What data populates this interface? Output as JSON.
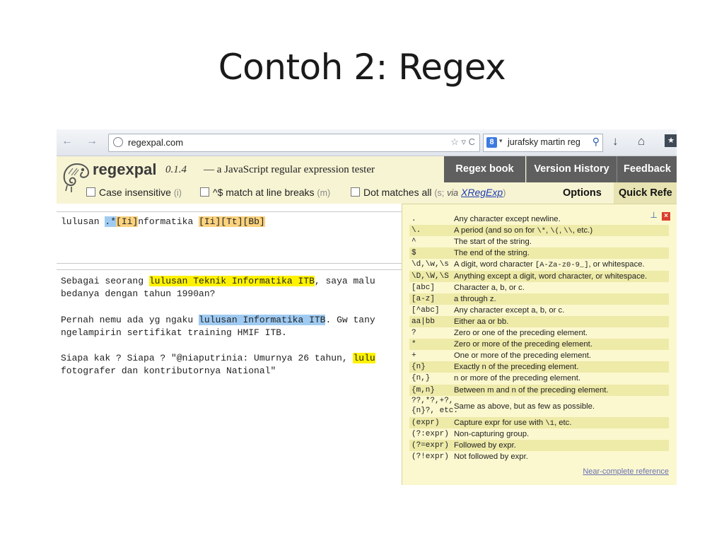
{
  "slide": {
    "title": "Contoh 2: Regex"
  },
  "browser": {
    "back_icon": "arrow-left-icon",
    "forward_icon": "arrow-right-icon",
    "url": "regexpal.com",
    "url_controls": "☆ ▿ C",
    "search_engine_badge": "8",
    "search_text": "jurafsky martin reg",
    "download_icon": "↓",
    "home_icon": "⌂"
  },
  "regexpal": {
    "name": "regexpal",
    "version": "0.1.4",
    "tagline": "— a JavaScript regular expression tester",
    "nav": [
      "Regex book",
      "Version History",
      "Feedback"
    ],
    "options": {
      "case_insensitive": "Case insensitive",
      "case_insensitive_key": "(i)",
      "line_breaks": "^$ match at line breaks",
      "line_breaks_key": "(m)",
      "dot_all": "Dot matches all",
      "dot_all_key": "(s;",
      "via": "via",
      "xregexp": "XRegExp",
      "close_paren": ")"
    },
    "tabs": [
      "Options",
      "Quick Refe"
    ]
  },
  "regex_input": {
    "segments": [
      {
        "text": "lulusan ",
        "hl": ""
      },
      {
        "text": ".*",
        "hl": "blue"
      },
      {
        "text": "[Ii]",
        "hl": "orange"
      },
      {
        "text": "nformatika ",
        "hl": ""
      },
      {
        "text": "[Ii]",
        "hl": "orange"
      },
      {
        "text": "[Tt]",
        "hl": "orange"
      },
      {
        "text": "[Bb]",
        "hl": "orange"
      }
    ]
  },
  "test_text": {
    "lines": [
      [
        {
          "text": "Sebagai seorang ",
          "hl": ""
        },
        {
          "text": "lulusan Teknik Informatika ITB",
          "hl": "yellow"
        },
        {
          "text": ", saya malu",
          "hl": ""
        }
      ],
      [
        {
          "text": "bedanya dengan tahun 1990an?",
          "hl": ""
        }
      ],
      [],
      [
        {
          "text": "Pernah nemu ada yg ngaku ",
          "hl": ""
        },
        {
          "text": "lulusan Informatika ITB",
          "hl": "blue"
        },
        {
          "text": ". Gw tany",
          "hl": ""
        }
      ],
      [
        {
          "text": "ngelampirin sertifikat training HMIF ITB.",
          "hl": ""
        }
      ],
      [],
      [
        {
          "text": "Siapa kak ? Siapa ? \"@niaputrinia: Umurnya 26 tahun, ",
          "hl": ""
        },
        {
          "text": "lulu",
          "hl": "yellow"
        }
      ],
      [
        {
          "text": "fotografer dan kontributornya National\"",
          "hl": ""
        }
      ]
    ]
  },
  "quick_reference": {
    "pin_icon": "⊥",
    "close_icon": "×",
    "rows": [
      {
        "token": ".",
        "desc": [
          {
            "t": "Any character except newline."
          }
        ]
      },
      {
        "token": "\\.",
        "desc": [
          {
            "t": "A period (and so on for "
          },
          {
            "t": "\\*",
            "m": true
          },
          {
            "t": ", "
          },
          {
            "t": "\\(",
            "m": true
          },
          {
            "t": ", "
          },
          {
            "t": "\\\\",
            "m": true
          },
          {
            "t": ", etc.)"
          }
        ]
      },
      {
        "token": "^",
        "desc": [
          {
            "t": "The start of the string."
          }
        ]
      },
      {
        "token": "$",
        "desc": [
          {
            "t": "The end of the string."
          }
        ]
      },
      {
        "token": "\\d,\\w,\\s",
        "desc": [
          {
            "t": "A digit, word character "
          },
          {
            "t": "[A-Za-z0-9_]",
            "m": true
          },
          {
            "t": ", or whitespace."
          }
        ]
      },
      {
        "token": "\\D,\\W,\\S",
        "desc": [
          {
            "t": "Anything except a digit, word character, or whitespace."
          }
        ]
      },
      {
        "token": "[abc]",
        "desc": [
          {
            "t": "Character a, b, or c."
          }
        ]
      },
      {
        "token": "[a-z]",
        "desc": [
          {
            "t": "a through z."
          }
        ]
      },
      {
        "token": "[^abc]",
        "desc": [
          {
            "t": "Any character except a, b, or c."
          }
        ]
      },
      {
        "token": "aa|bb",
        "desc": [
          {
            "t": "Either aa or bb."
          }
        ]
      },
      {
        "token": "?",
        "desc": [
          {
            "t": "Zero or one of the preceding element."
          }
        ]
      },
      {
        "token": "*",
        "desc": [
          {
            "t": "Zero or more of the preceding element."
          }
        ]
      },
      {
        "token": "+",
        "desc": [
          {
            "t": "One or more of the preceding element."
          }
        ]
      },
      {
        "token": "{n}",
        "desc": [
          {
            "t": "Exactly n of the preceding element."
          }
        ]
      },
      {
        "token": "{n,}",
        "desc": [
          {
            "t": "n or more of the preceding element."
          }
        ]
      },
      {
        "token": "{m,n}",
        "desc": [
          {
            "t": "Between m and n of the preceding element."
          }
        ]
      },
      {
        "token": "??,*?,+?,\n{n}?, etc.",
        "desc": [
          {
            "t": "Same as above, but as few as possible."
          }
        ]
      },
      {
        "token": "(expr)",
        "desc": [
          {
            "t": "Capture expr for use with "
          },
          {
            "t": "\\1",
            "m": true
          },
          {
            "t": ", etc."
          }
        ]
      },
      {
        "token": "(?:expr)",
        "desc": [
          {
            "t": "Non-capturing group."
          }
        ]
      },
      {
        "token": "(?=expr)",
        "desc": [
          {
            "t": "Followed by expr."
          }
        ]
      },
      {
        "token": "(?!expr)",
        "desc": [
          {
            "t": "Not followed by expr."
          }
        ]
      }
    ],
    "footer_link": "Near-complete reference"
  }
}
